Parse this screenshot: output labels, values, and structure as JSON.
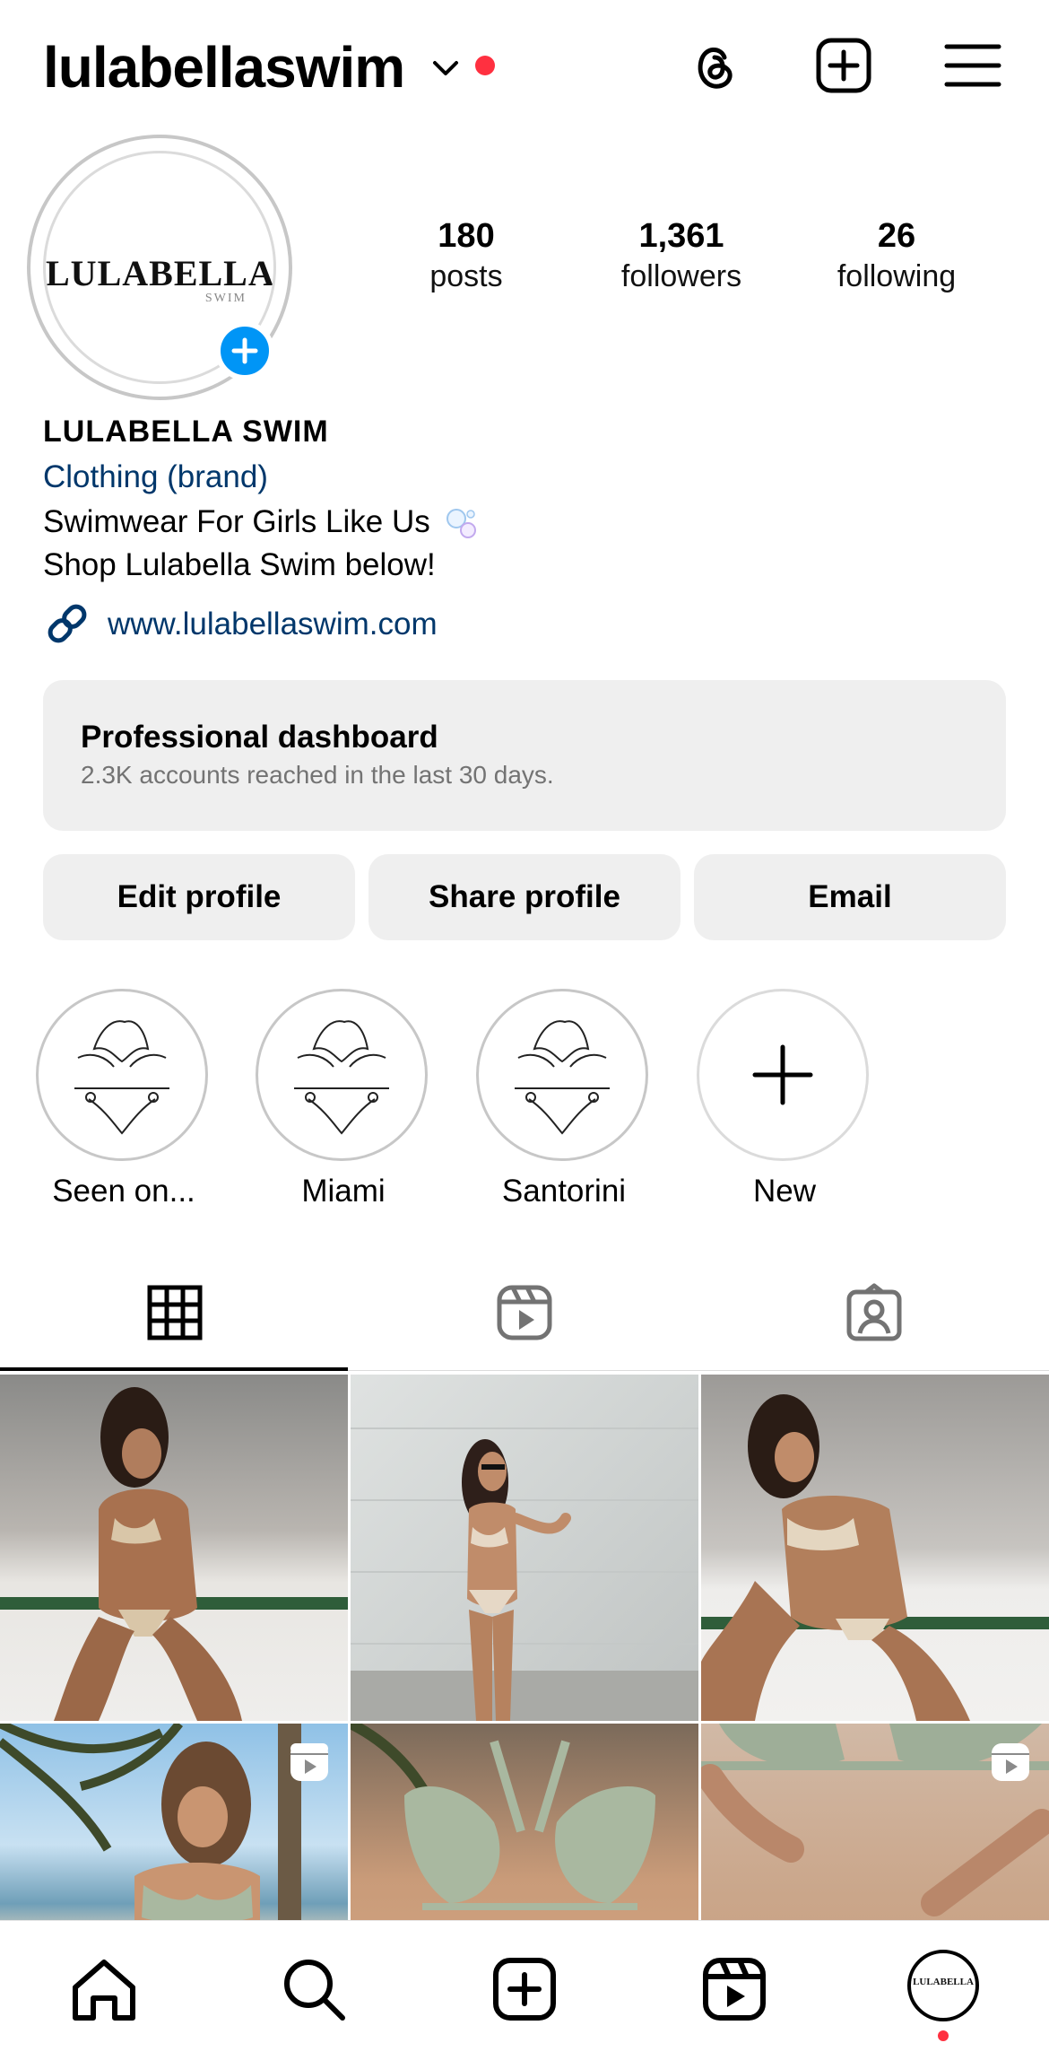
{
  "header": {
    "username": "lulabellaswim",
    "icons": [
      "chevron-down-icon",
      "notification-dot",
      "threads-icon",
      "create-post-icon",
      "menu-icon"
    ],
    "dot_color": "#ff3040"
  },
  "profile": {
    "avatar_logo": "LULABELLA",
    "avatar_logo_sub": "SWIM",
    "stats": {
      "posts": {
        "value": "180",
        "label": "posts"
      },
      "followers": {
        "value": "1,361",
        "label": "followers"
      },
      "following": {
        "value": "26",
        "label": "following"
      }
    },
    "full_name": "LULABELLA SWIM",
    "category": "Clothing (brand)",
    "bio_line1": "Swimwear For Girls Like Us",
    "bio_line2": "Shop Lulabella Swim below!",
    "website": "www.lulabellaswim.com",
    "link_color": "#00376b",
    "add_story_color": "#0095f6"
  },
  "dashboard": {
    "title": "Professional dashboard",
    "subtitle": "2.3K accounts reached in the last 30 days."
  },
  "buttons": {
    "edit": "Edit profile",
    "share": "Share profile",
    "email": "Email"
  },
  "highlights": [
    {
      "label": "Seen on..."
    },
    {
      "label": "Miami"
    },
    {
      "label": "Santorini"
    },
    {
      "label": "New"
    }
  ],
  "tabs": [
    {
      "name": "posts-grid",
      "icon": "grid-icon",
      "active": true
    },
    {
      "name": "reels",
      "icon": "reels-icon",
      "active": false
    },
    {
      "name": "tagged",
      "icon": "tagged-icon",
      "active": false
    }
  ],
  "posts": [
    {
      "description": "swimwear-photo-1",
      "type": "photo"
    },
    {
      "description": "swimwear-photo-2",
      "type": "photo"
    },
    {
      "description": "swimwear-photo-3",
      "type": "photo"
    },
    {
      "description": "swimwear-photo-4",
      "type": "reel"
    },
    {
      "description": "swimwear-photo-5",
      "type": "photo"
    },
    {
      "description": "swimwear-photo-6",
      "type": "reel"
    }
  ],
  "bottom_nav": {
    "items": [
      "home-icon",
      "search-icon",
      "create-icon",
      "reels-icon",
      "profile-avatar"
    ],
    "avatar_logo": "LULABELLA"
  }
}
